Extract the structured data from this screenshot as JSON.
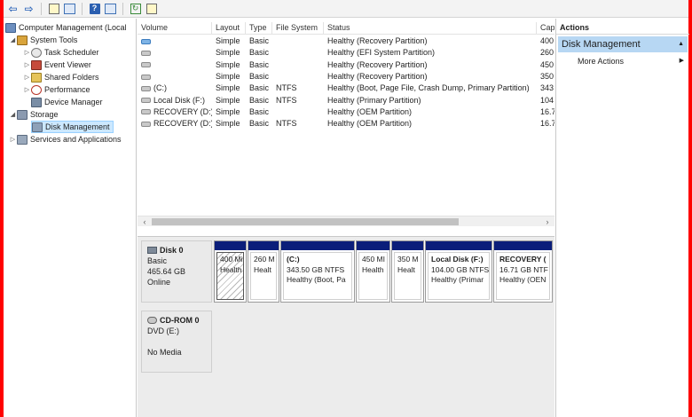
{
  "toolbar": {
    "buttons": [
      "back-arrow-icon",
      "forward-arrow-icon",
      "up-folder-icon",
      "show-hide-tree-icon",
      "help-icon",
      "show-pane-icon",
      "refresh-icon",
      "properties-icon"
    ]
  },
  "tree": {
    "root": "Computer Management (Local",
    "system_tools": "System Tools",
    "task_scheduler": "Task Scheduler",
    "event_viewer": "Event Viewer",
    "shared_folders": "Shared Folders",
    "performance": "Performance",
    "device_manager": "Device Manager",
    "storage": "Storage",
    "disk_management": "Disk Management",
    "services": "Services and Applications"
  },
  "volumes": {
    "headers": [
      "Volume",
      "Layout",
      "Type",
      "File System",
      "Status",
      "Cap"
    ],
    "rows": [
      {
        "volume": "",
        "layout": "Simple",
        "type": "Basic",
        "fs": "",
        "status": "Healthy (Recovery Partition)",
        "cap": "400"
      },
      {
        "volume": "",
        "layout": "Simple",
        "type": "Basic",
        "fs": "",
        "status": "Healthy (EFI System Partition)",
        "cap": "260"
      },
      {
        "volume": "",
        "layout": "Simple",
        "type": "Basic",
        "fs": "",
        "status": "Healthy (Recovery Partition)",
        "cap": "450"
      },
      {
        "volume": "",
        "layout": "Simple",
        "type": "Basic",
        "fs": "",
        "status": "Healthy (Recovery Partition)",
        "cap": "350"
      },
      {
        "volume": "(C:)",
        "layout": "Simple",
        "type": "Basic",
        "fs": "NTFS",
        "status": "Healthy (Boot, Page File, Crash Dump, Primary Partition)",
        "cap": "343"
      },
      {
        "volume": "Local Disk (F:)",
        "layout": "Simple",
        "type": "Basic",
        "fs": "NTFS",
        "status": "Healthy (Primary Partition)",
        "cap": "104"
      },
      {
        "volume": "RECOVERY (D:)",
        "layout": "Simple",
        "type": "Basic",
        "fs": "",
        "status": "Healthy (OEM Partition)",
        "cap": "16.7"
      },
      {
        "volume": "RECOVERY (D:)",
        "layout": "Simple",
        "type": "Basic",
        "fs": "NTFS",
        "status": "Healthy (OEM Partition)",
        "cap": "16.7"
      }
    ]
  },
  "disk0": {
    "name": "Disk 0",
    "kind": "Basic",
    "size": "465.64 GB",
    "state": "Online",
    "partitions": [
      {
        "title": "",
        "line1": "400 Mi",
        "line2": "Health"
      },
      {
        "title": "",
        "line1": "260 M",
        "line2": "Healt"
      },
      {
        "title": "(C:)",
        "line1": "343.50 GB NTFS",
        "line2": "Healthy (Boot, Pa"
      },
      {
        "title": "",
        "line1": "450 MI",
        "line2": "Health"
      },
      {
        "title": "",
        "line1": "350 M",
        "line2": "Healt"
      },
      {
        "title": "Local Disk  (F:)",
        "line1": "104.00 GB NTFS",
        "line2": "Healthy (Primar"
      },
      {
        "title": "RECOVERY  (",
        "line1": "16.71 GB NTF",
        "line2": "Healthy (OEN"
      }
    ]
  },
  "cdrom0": {
    "name": "CD-ROM 0",
    "kind": "DVD (E:)",
    "state": "No Media"
  },
  "actions": {
    "header": "Actions",
    "section": "Disk Management",
    "more": "More Actions"
  }
}
